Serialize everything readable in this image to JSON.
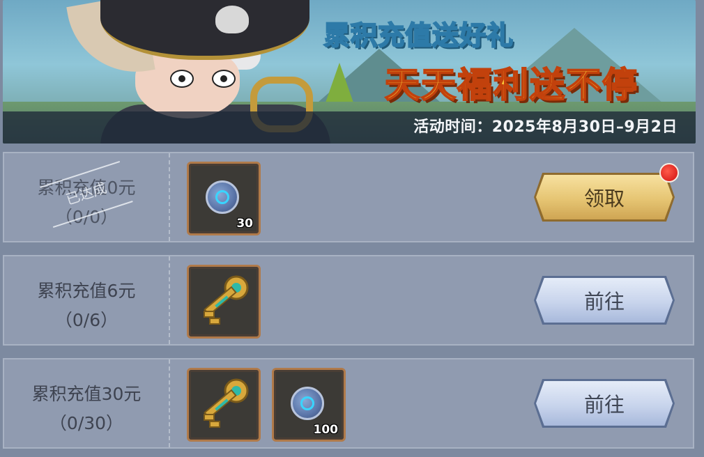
{
  "banner": {
    "title_line1": "累积充值送好礼",
    "title_line2": "天天福利送不停",
    "date_text": "活动时间：2025年8月30日–9月2日"
  },
  "rows": [
    {
      "requirement": "累积充值0元",
      "progress": "（0/0）",
      "status_stamp": "已达成",
      "rewards": [
        {
          "icon": "coin-icon",
          "quantity": "30"
        }
      ],
      "button": {
        "label": "领取",
        "style": "gold",
        "has_notification": true
      }
    },
    {
      "requirement": "累积充值6元",
      "progress": "（0/6）",
      "rewards": [
        {
          "icon": "key-icon",
          "quantity": ""
        }
      ],
      "button": {
        "label": "前往",
        "style": "blue",
        "has_notification": false
      }
    },
    {
      "requirement": "累积充值30元",
      "progress": "（0/30）",
      "rewards": [
        {
          "icon": "key-icon",
          "quantity": ""
        },
        {
          "icon": "coin-icon",
          "quantity": "100"
        }
      ],
      "button": {
        "label": "前往",
        "style": "blue",
        "has_notification": false
      }
    }
  ],
  "colors": {
    "claim_button": "#e6c573",
    "goto_button": "#c8d4ec",
    "notification_dot": "#d01010",
    "item_frame": "#b07a4a"
  }
}
